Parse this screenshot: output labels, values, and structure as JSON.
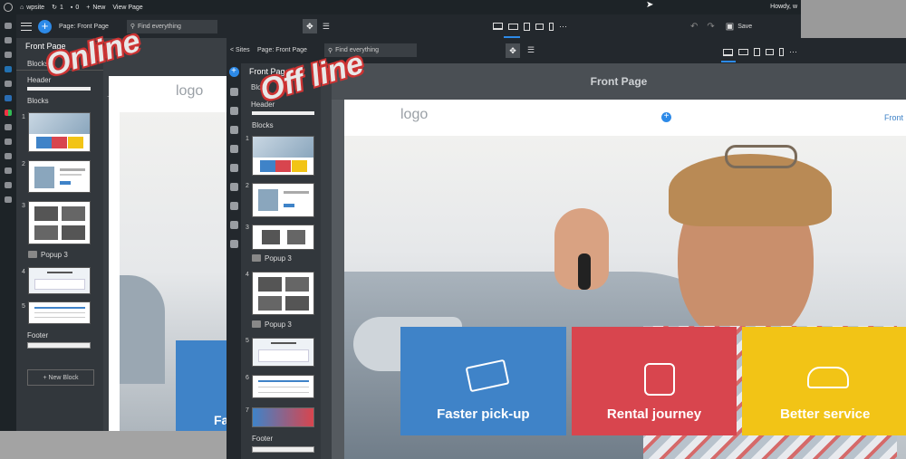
{
  "wp_admin_bar": {
    "site_name": "wpsite",
    "updates_count": "1",
    "comments_count": "0",
    "new_label": "New",
    "view_page_label": "View Page",
    "howdy": "Howdy, w"
  },
  "online": {
    "overlay_label": "Online",
    "page_label": "Page: Front Page",
    "search_placeholder": "Find everything",
    "save_label": "Save",
    "panel_title": "Front Page",
    "tab_blocks": "Blocks",
    "header_label": "Header",
    "blocks_label": "Blocks",
    "block_numbers": [
      "1",
      "2",
      "3",
      "4",
      "5"
    ],
    "popup_label": "Popup 3",
    "footer_label": "Footer",
    "new_block_label": "New Block",
    "more_icon": "..."
  },
  "offline": {
    "overlay_label": "Off line",
    "sites_label": "< Sites",
    "page_label": "Page: Front Page",
    "search_placeholder": "Find everything",
    "panel_title": "Front Page",
    "tab_blocks": "Block",
    "header_label": "Header",
    "blocks_label": "Blocks",
    "block_numbers": [
      "1",
      "2",
      "3",
      "4",
      "5",
      "6",
      "7"
    ],
    "popup_label_1": "Popup 3",
    "popup_label_2": "Popup 3",
    "footer_label": "Footer",
    "viewport_title": "Front Page",
    "site_logo": "logo",
    "site_nav_link": "Front",
    "cards": [
      {
        "label": "Faster pick-up",
        "color": "#3f83c8"
      },
      {
        "label": "Rental journey",
        "color": "#d8454e"
      },
      {
        "label": "Better service",
        "color": "#f2c416"
      }
    ]
  },
  "online_canvas": {
    "site_logo": "logo",
    "card_fragment": "Fa"
  },
  "colors": {
    "accent": "#2d8ae8",
    "overlay_text": "#d33"
  }
}
